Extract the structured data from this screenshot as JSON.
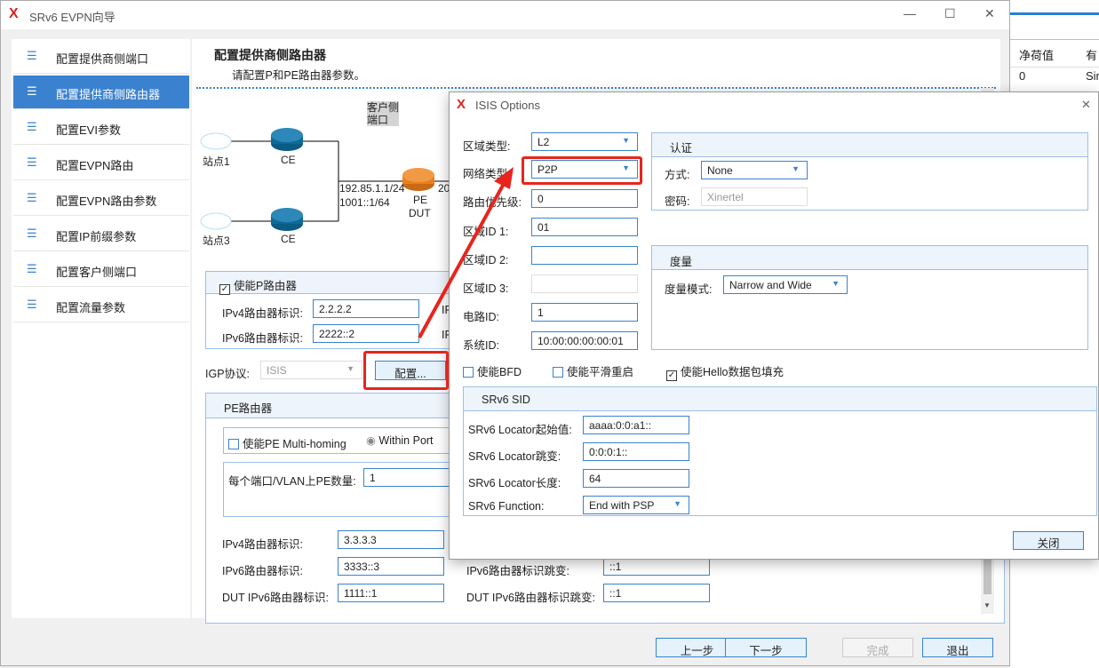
{
  "window": {
    "title": "SRv6 EVPN向导",
    "min": "—",
    "max": "☐",
    "close": "✕"
  },
  "background_app": {
    "headers": [
      "净荷值",
      "有"
    ],
    "row": [
      "0",
      "Sir"
    ]
  },
  "sidebar": {
    "items": [
      {
        "label": "配置提供商侧端口"
      },
      {
        "label": "配置提供商侧路由器",
        "active": true
      },
      {
        "label": "配置EVI参数"
      },
      {
        "label": "配置EVPN路由"
      },
      {
        "label": "配置EVPN路由参数"
      },
      {
        "label": "配置IP前缀参数"
      },
      {
        "label": "配置客户侧端口"
      },
      {
        "label": "配置流量参数"
      }
    ]
  },
  "page": {
    "title": "配置提供商侧路由器",
    "subtitle": "请配置P和PE路由器参数。"
  },
  "diagram": {
    "customer_port": "客户侧端口",
    "site1": "站点1",
    "site3": "站点3",
    "ce": "CE",
    "ip4": "192.85.1.1/24",
    "ip6": "1001::1/64",
    "pe": "PE",
    "dut": "DUT",
    "trunc": "20"
  },
  "p_router": {
    "enable_label": "使能P路由器",
    "enabled": true,
    "ipv4_label": "IPv4路由器标识:",
    "ipv4": "2.2.2.2",
    "ipv6_label": "IPv6路由器标识:",
    "ipv6": "2222::2",
    "trunc": "IP"
  },
  "igp": {
    "label": "IGP协议:",
    "value": "ISIS",
    "config_button": "配置..."
  },
  "pe_router": {
    "title": "PE路由器",
    "multihoming_label": "使能PE Multi-homing",
    "multihoming": false,
    "within_port": "Within Port",
    "pe_count_label": "每个端口/VLAN上PE数量:",
    "pe_count": "1",
    "ipv4_label": "IPv4路由器标识:",
    "ipv4": "3.3.3.3",
    "ipv6_label": "IPv6路由器标识:",
    "ipv6": "3333::3",
    "ipv6_step_label": "IPv6路由器标识跳变:",
    "ipv6_step": "::1",
    "dut_ipv6_label": "DUT IPv6路由器标识:",
    "dut_ipv6": "1111::1",
    "dut_ipv6_step_label": "DUT IPv6路由器标识跳变:",
    "dut_ipv6_step": "::1"
  },
  "footer": {
    "prev": "上一步",
    "next": "下一步",
    "finish": "完成",
    "exit": "退出"
  },
  "dialog": {
    "title": "ISIS Options",
    "close_x": "✕",
    "area_type_label": "区域类型:",
    "area_type": "L2",
    "net_type_label": "网络类型:",
    "net_type": "P2P",
    "priority_label": "路由优先级:",
    "priority": "0",
    "area1_label": "区域ID 1:",
    "area1": "01",
    "area2_label": "区域ID 2:",
    "area2": "",
    "area3_label": "区域ID 3:",
    "area3": "",
    "circuit_label": "电路ID:",
    "circuit": "1",
    "sysid_label": "系统ID:",
    "sysid": "10:00:00:00:00:01",
    "auth": {
      "title": "认证",
      "mode_label": "方式:",
      "mode": "None",
      "pwd_label": "密码:",
      "pwd": "Xinertel"
    },
    "metric": {
      "title": "度量",
      "mode_label": "度量模式:",
      "mode": "Narrow and Wide"
    },
    "bfd_label": "使能BFD",
    "bfd": false,
    "gr_label": "使能平滑重启",
    "gr": false,
    "hello_label": "使能Hello数据包填充",
    "hello": true,
    "srv6": {
      "title": "SRv6 SID",
      "loc_start_label": "SRv6 Locator起始值:",
      "loc_start": "aaaa:0:0:a1::",
      "loc_step_label": "SRv6 Locator跳变:",
      "loc_step": "0:0:0:1::",
      "loc_len_label": "SRv6 Locator长度:",
      "loc_len": "64",
      "func_label": "SRv6 Function:",
      "func": "End with PSP"
    },
    "close_button": "关闭"
  },
  "colors": {
    "accent": "#3a82cf",
    "annotation": "#e8241c",
    "pe_router": "#e8801e",
    "ce_router": "#0e6a98"
  }
}
